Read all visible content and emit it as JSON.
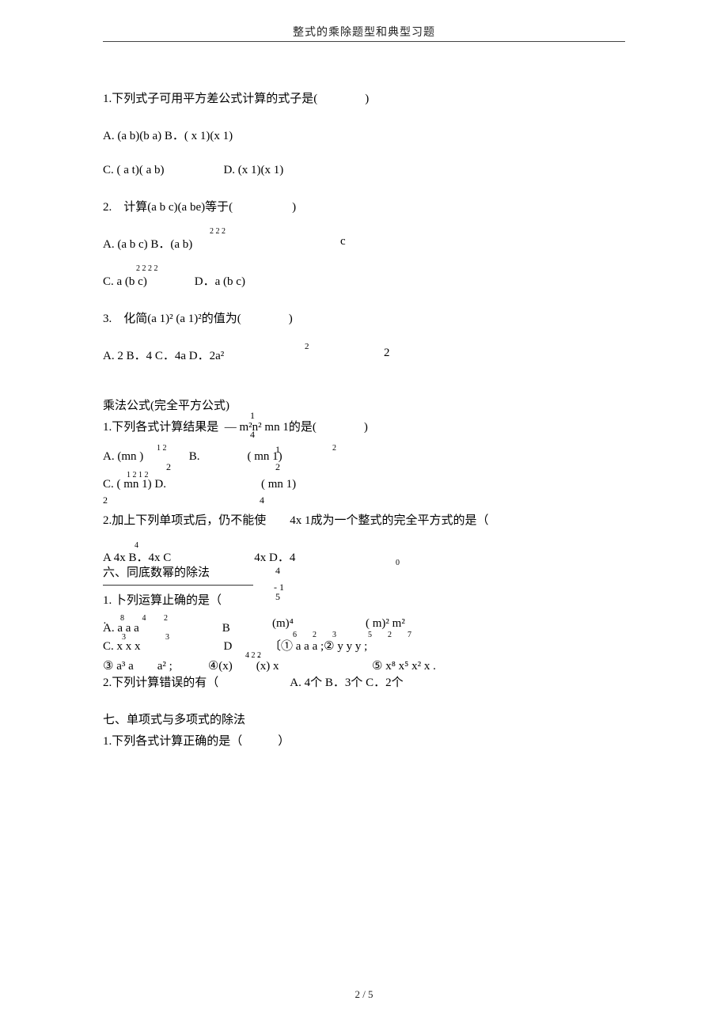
{
  "header": {
    "title": "整式的乘除题型和典型习题"
  },
  "sec_diff": {
    "q1": "1.下列式子可用平方差公式计算的式子是(    )",
    "q1_a": "A. (a b)(b a) B．( x 1)(x 1)",
    "q1_c": "C. ( a t)( a b)     D. (x 1)(x 1)",
    "q2": "2. 计算(a b c)(a be)等于(     )",
    "q2_a": "A. (a b c) B．(a b)",
    "q2_a_sup": "2 2 2",
    "q2_c_right": "c",
    "q2_c": "C. a (b c)    D．a (b c)",
    "q2_c_sup": "2 2 2 2",
    "q3": "3. 化简(a 1)² (a 1)²的值为(    )",
    "q3_a": "A. 2 B．4 C．4a D．2a²",
    "q3_a_far1": "2",
    "q3_a_far2": "2"
  },
  "sec_perfect": {
    "title": "乘法公式(完全平方公式)",
    "q1_pre": "1.下列各式计算结果是 — m²n² mn 1的是(    )",
    "q1_frac_top": "1",
    "q1_frac_bot": "4",
    "q1_a": "A. (mn )",
    "q1_a_sup1": "1 2",
    "q1_a_sup2": "2",
    "q1_b": "B.    ( mn 1)",
    "q1_b_frac_top": "1",
    "q1_b_frac_bot": "2",
    "q1_b_sup": "2",
    "q1_c": "C. ( mn 1) D.        ( mn 1)",
    "q1_c_sup": "1 2 1 2",
    "q1_c_bot": "2                4",
    "q2": "2.加上下列单项式后，仍不能使  4x 1成为一个整式的完全平方式的是（",
    "q2_opts": "A 4x B．4x C       4x D．4",
    "q2_opts_sup": "4"
  },
  "sec_div": {
    "title": "六、同底数幂的除法",
    "side_num": "4",
    "side_mid": "- 1",
    "side_bot": "5",
    "side_sup": "0",
    "q1": "1. 卜列运算止确的是（",
    "q1_a": "A. a a a       B",
    "q1_a_sup": "8   4   2",
    "q1_a_dot": "．",
    "q1_b_right1": "(m)⁴",
    "q1_b_right2": "( m)² m²",
    "q1_c": "C. x x x       D",
    "q1_c_sup": "3     3",
    "q1_c_dot": "．",
    "q1_c_right": "〔① a a a ;② y y y ;",
    "q1_c_right_sup": "6  2  3    5  2  7",
    "q2_line3": "③ a³ a  a² ;   ④(x)  (x) x",
    "q2_line3_sup": "4 2 2",
    "q2_line3_right": "⑤ x⁸  x⁵ x² x .",
    "q2": "2.下列计算错误的有（      A. 4个 B．3个 C．2个"
  },
  "sec_poly": {
    "title": "七、单项式与多项式的除法",
    "q1": "1.下列各式计算正确的是（   ）"
  },
  "footer": "2 / 5"
}
